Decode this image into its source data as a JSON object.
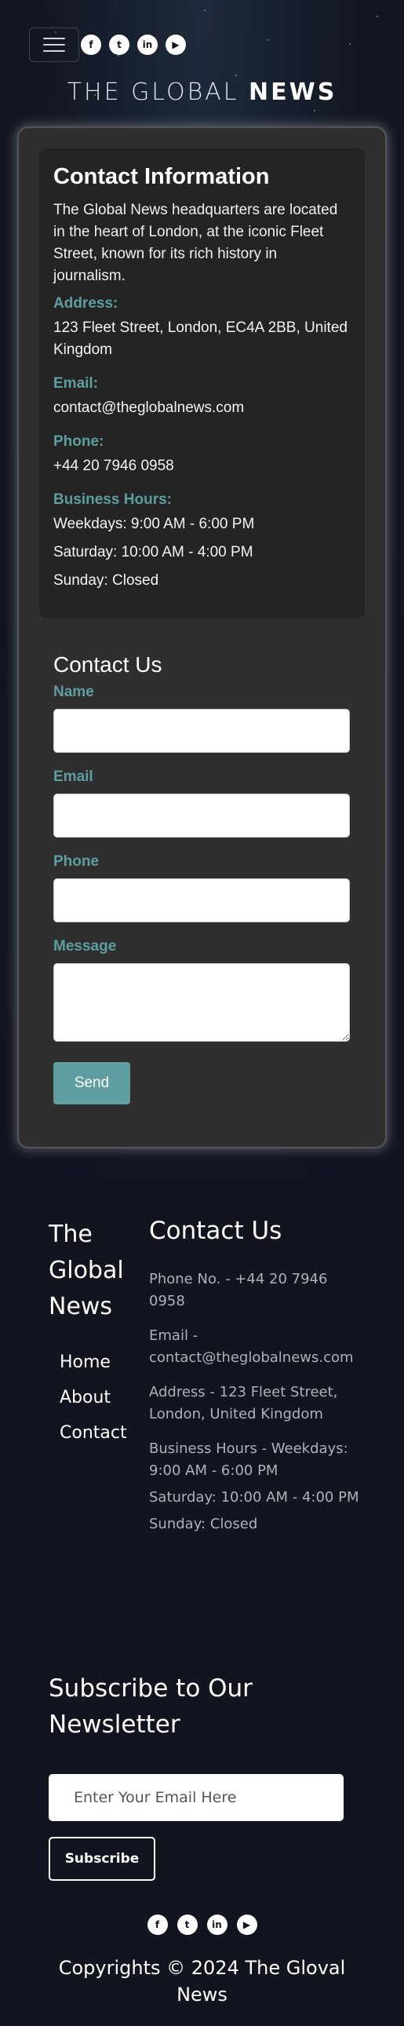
{
  "brand": {
    "light": "THE GLOBAL",
    "bold": "NEWS"
  },
  "social_icons": [
    {
      "icon": "facebook-icon",
      "glyph": "f"
    },
    {
      "icon": "twitter-icon",
      "glyph": "t"
    },
    {
      "icon": "linkedin-icon",
      "glyph": "in"
    },
    {
      "icon": "youtube-icon",
      "glyph": "▶"
    }
  ],
  "info": {
    "title": "Contact Information",
    "intro": "The Global News headquarters are located in the heart of London, at the iconic Fleet Street, known for its rich history in journalism.",
    "address_label": "Address:",
    "address": "123 Fleet Street, London, EC4A 2BB, United Kingdom",
    "email_label": "Email:",
    "email": "contact@theglobalnews.com",
    "phone_label": "Phone:",
    "phone": "+44 20 7946 0958",
    "hours_label": "Business Hours:",
    "hours_weekdays": "Weekdays: 9:00 AM - 6:00 PM",
    "hours_saturday": "Saturday: 10:00 AM - 4:00 PM",
    "hours_sunday": "Sunday: Closed"
  },
  "form": {
    "title": "Contact Us",
    "name_label": "Name",
    "email_label": "Email",
    "phone_label": "Phone",
    "message_label": "Message",
    "send_label": "Send"
  },
  "footer": {
    "brand": "The Global News",
    "links": [
      "Home",
      "About",
      "Contact"
    ],
    "contact_title": "Contact Us",
    "phone": "Phone No. - +44 20 7946 0958",
    "email": "Email - contact@theglobalnews.com",
    "address": "Address - 123 Fleet Street, London, United Kingdom",
    "hours_weekdays": "Business Hours - Weekdays: 9:00 AM - 6:00 PM",
    "hours_saturday": "Saturday: 10:00 AM - 4:00 PM",
    "hours_sunday": "Sunday: Closed",
    "newsletter_title": "Subscribe to Our Newsletter",
    "newsletter_placeholder": "Enter Your Email Here",
    "subscribe_label": "Subscribe",
    "copyright": "Copyrights © 2024 The Gloval News"
  },
  "colors": {
    "accent": "#5f9ea0",
    "background": "#121420",
    "card": "#2f2f2f"
  }
}
